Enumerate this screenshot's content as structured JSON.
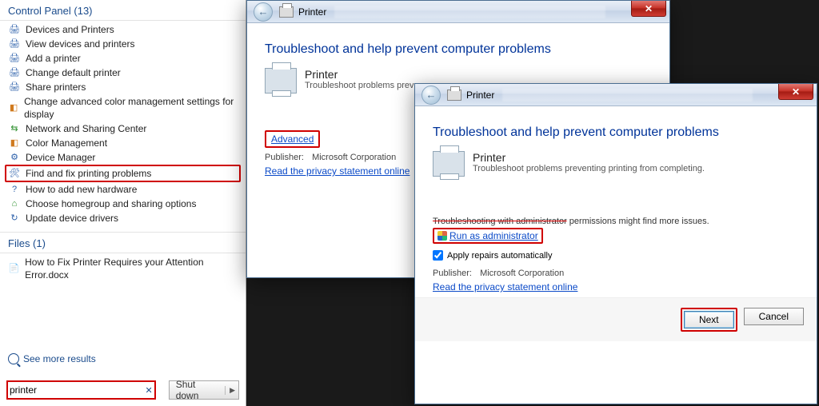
{
  "start": {
    "control_panel_header": "Control Panel (13)",
    "items": [
      "Devices and Printers",
      "View devices and printers",
      "Add a printer",
      "Change default printer",
      "Share printers",
      "Change advanced color management settings for display",
      "Network and Sharing Center",
      "Color Management",
      "Device Manager",
      "Find and fix printing problems",
      "How to add new hardware",
      "Choose homegroup and sharing options",
      "Update device drivers"
    ],
    "files_header": "Files (1)",
    "file_item": "How to Fix Printer Requires your Attention Error.docx",
    "see_more": "See more results",
    "search_value": "printer",
    "shutdown_label": "Shut down"
  },
  "win1": {
    "title": "Printer",
    "heading": "Troubleshoot and help prevent computer problems",
    "printer_title": "Printer",
    "printer_sub": "Troubleshoot problems preve",
    "advanced": "Advanced",
    "publisher_label": "Publisher:",
    "publisher_value": "Microsoft Corporation",
    "privacy": "Read the privacy statement online"
  },
  "win2": {
    "title": "Printer",
    "heading": "Troubleshoot and help prevent computer problems",
    "printer_title": "Printer",
    "printer_sub": "Troubleshoot problems preventing printing from completing.",
    "admin_note_pre": "Troubleshooting with administrator",
    "admin_note_post": " permissions might find more issues.",
    "run_admin": "Run as administrator",
    "apply_repairs": "Apply repairs automatically",
    "publisher_label": "Publisher:",
    "publisher_value": "Microsoft Corporation",
    "privacy": "Read the privacy statement online",
    "next": "Next",
    "cancel": "Cancel"
  }
}
